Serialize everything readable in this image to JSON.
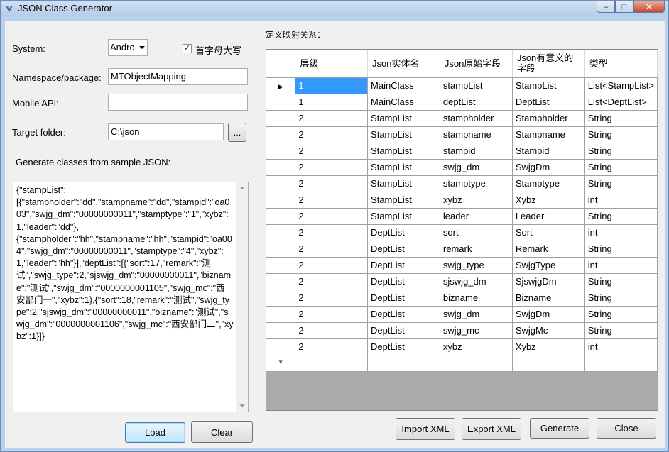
{
  "window": {
    "title": "JSON Class Generator",
    "minimize_label": "–",
    "maximize_label": "□",
    "close_label": "✕"
  },
  "form": {
    "system_label": "System:",
    "system_value": "Andrc",
    "capitalize_label": "首字母大写",
    "capitalize_checked": "✓",
    "namespace_label": "Namespace/package:",
    "namespace_value": "MTObjectMapping",
    "mobile_api_label": "Mobile API:",
    "mobile_api_value": "",
    "target_folder_label": "Target folder:",
    "target_folder_value": "C:\\json",
    "browse_label": "...",
    "sample_label": "Generate classes from sample JSON:",
    "sample_json": "{\"stampList\":\n[{\"stampholder\":\"dd\",\"stampname\":\"dd\",\"stampid\":\"oa003\",\"swjg_dm\":\"00000000011\",\"stamptype\":\"1\",\"xybz\":1,\"leader\":\"dd\"},\n{\"stampholder\":\"hh\",\"stampname\":\"hh\",\"stampid\":\"oa004\",\"swjg_dm\":\"00000000011\",\"stamptype\":\"4\",\"xybz\":1,\"leader\":\"hh\"}],\"deptList\":[{\"sort\":17,\"remark\":\"测\n试\",\"swjg_type\":2,\"sjswjg_dm\":\"00000000011\",\"bizname\":\"测试\",\"swjg_dm\":\"0000000001105\",\"swjg_mc\":\"西安部门一\",\"xybz\":1},{\"sort\":18,\"remark\":\"测试\",\"swjg_type\":2,\"sjswjg_dm\":\"00000000011\",\"bizname\":\"测试\",\"swjg_dm\":\"0000000001106\",\"swjg_mc\":\"西安部门二\",\"xybz\":1}]}",
    "load_label": "Load",
    "clear_label": "Clear"
  },
  "mapping": {
    "label": "定义映射关系：",
    "columns": [
      "层级",
      "Json实体名",
      "Json原始字段",
      "Json有意义的字段",
      "类型"
    ],
    "rows": [
      [
        "1",
        "MainClass",
        "stampList",
        "StampList",
        "List<StampList>"
      ],
      [
        "1",
        "MainClass",
        "deptList",
        "DeptList",
        "List<DeptList>"
      ],
      [
        "2",
        "StampList",
        "stampholder",
        "Stampholder",
        "String"
      ],
      [
        "2",
        "StampList",
        "stampname",
        "Stampname",
        "String"
      ],
      [
        "2",
        "StampList",
        "stampid",
        "Stampid",
        "String"
      ],
      [
        "2",
        "StampList",
        "swjg_dm",
        "SwjgDm",
        "String"
      ],
      [
        "2",
        "StampList",
        "stamptype",
        "Stamptype",
        "String"
      ],
      [
        "2",
        "StampList",
        "xybz",
        "Xybz",
        "int"
      ],
      [
        "2",
        "StampList",
        "leader",
        "Leader",
        "String"
      ],
      [
        "2",
        "DeptList",
        "sort",
        "Sort",
        "int"
      ],
      [
        "2",
        "DeptList",
        "remark",
        "Remark",
        "String"
      ],
      [
        "2",
        "DeptList",
        "swjg_type",
        "SwjgType",
        "int"
      ],
      [
        "2",
        "DeptList",
        "sjswjg_dm",
        "SjswjgDm",
        "String"
      ],
      [
        "2",
        "DeptList",
        "bizname",
        "Bizname",
        "String"
      ],
      [
        "2",
        "DeptList",
        "swjg_dm",
        "SwjgDm",
        "String"
      ],
      [
        "2",
        "DeptList",
        "swjg_mc",
        "SwjgMc",
        "String"
      ],
      [
        "2",
        "DeptList",
        "xybz",
        "Xybz",
        "int"
      ]
    ],
    "current_row_marker": "▶",
    "new_row_marker": "*"
  },
  "actions": {
    "import_label": "Import XML",
    "export_label": "Export XML",
    "generate_label": "Generate",
    "close_label": "Close"
  }
}
